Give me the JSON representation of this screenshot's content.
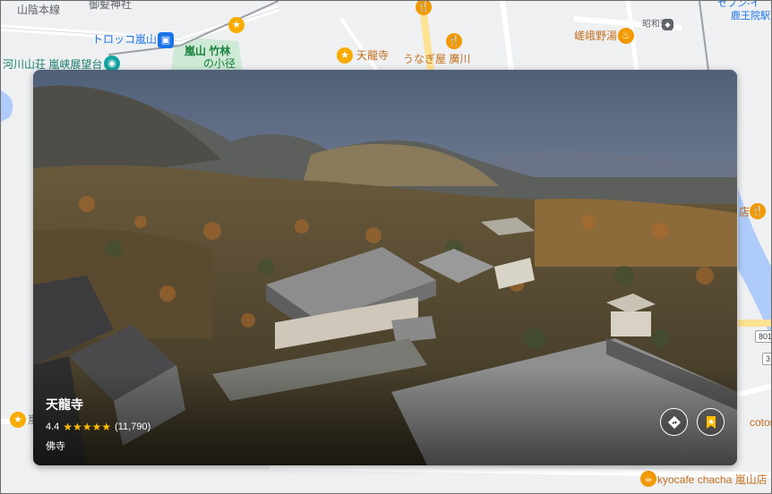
{
  "map": {
    "labels": {
      "road_top": "山陰本線",
      "shrine": "御髪神社",
      "torokko": "トロッコ嵐山",
      "arashiyama_bamboo_1": "嵐山 竹林",
      "arashiyama_bamboo_2": "の小径",
      "tenryuji_map": "天龍寺",
      "unagi": "うなぎ屋 廣川",
      "sagano_yu": "嵯峨野湯",
      "showa": "昭和通",
      "museum": "河川山荘 嵐峡展望台",
      "station_top_right_1": "セブン-イ",
      "station_top_right_2": "鹿王院駅",
      "right_edge_1": "店",
      "kyocafe": "kyocafe chacha 嵐山店",
      "right_edge_2": "coton",
      "left_edge": "嵐",
      "road_num": "801",
      "road_num2": "3"
    }
  },
  "place": {
    "name": "天龍寺",
    "rating": "4.4",
    "stars": "★★★★★",
    "reviews": "(11,790)",
    "category": "佛寺"
  },
  "buttons": {
    "directions_icon": "directions-icon",
    "save_icon": "bookmark-icon"
  },
  "colors": {
    "star": "#fbbc04",
    "pin_orange": "#f29900",
    "pin_teal": "#12a4a0"
  }
}
